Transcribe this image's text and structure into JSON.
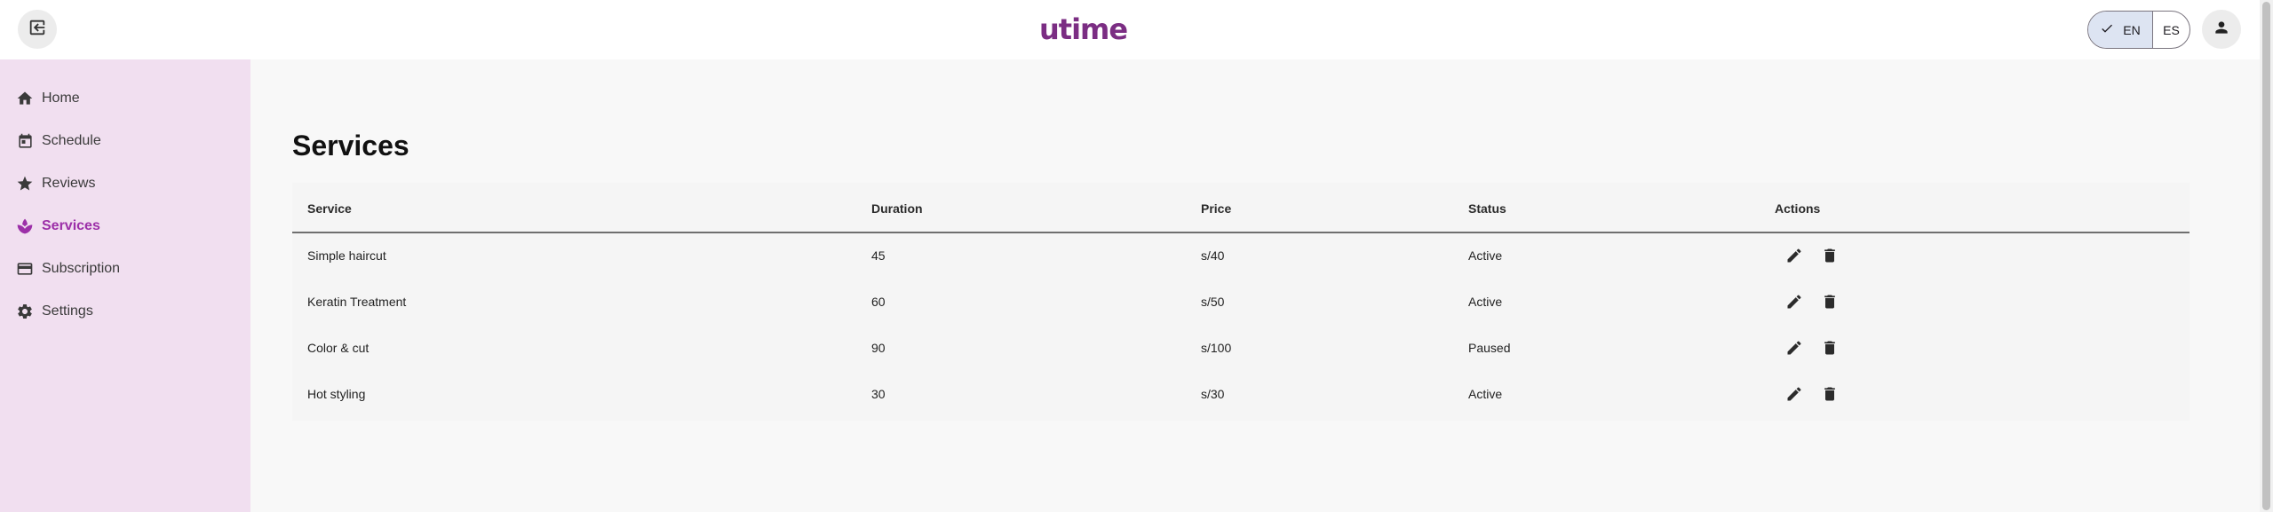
{
  "app": {
    "logo": "utime"
  },
  "header": {
    "logout_icon": "logout-icon",
    "languages": [
      {
        "code": "EN",
        "selected": true
      },
      {
        "code": "ES",
        "selected": false
      }
    ],
    "profile_icon": "person-icon"
  },
  "sidebar": {
    "items": [
      {
        "label": "Home",
        "icon": "home-icon",
        "active": false
      },
      {
        "label": "Schedule",
        "icon": "calendar-icon",
        "active": false
      },
      {
        "label": "Reviews",
        "icon": "star-icon",
        "active": false
      },
      {
        "label": "Services",
        "icon": "spa-icon",
        "active": true
      },
      {
        "label": "Subscription",
        "icon": "card-icon",
        "active": false
      },
      {
        "label": "Settings",
        "icon": "gear-icon",
        "active": false
      }
    ],
    "active_color": "#9c2fa8",
    "background": "#f1dff0"
  },
  "main": {
    "title": "Services",
    "table": {
      "headers": [
        "Service",
        "Duration",
        "Price",
        "Status",
        "Actions"
      ],
      "rows": [
        {
          "service": "Simple haircut",
          "duration": "45",
          "price": "s/40",
          "status": "Active"
        },
        {
          "service": "Keratin Treatment",
          "duration": "60",
          "price": "s/50",
          "status": "Active"
        },
        {
          "service": "Color & cut",
          "duration": "90",
          "price": "s/100",
          "status": "Paused"
        },
        {
          "service": "Hot styling",
          "duration": "30",
          "price": "s/30",
          "status": "Active"
        }
      ]
    }
  }
}
